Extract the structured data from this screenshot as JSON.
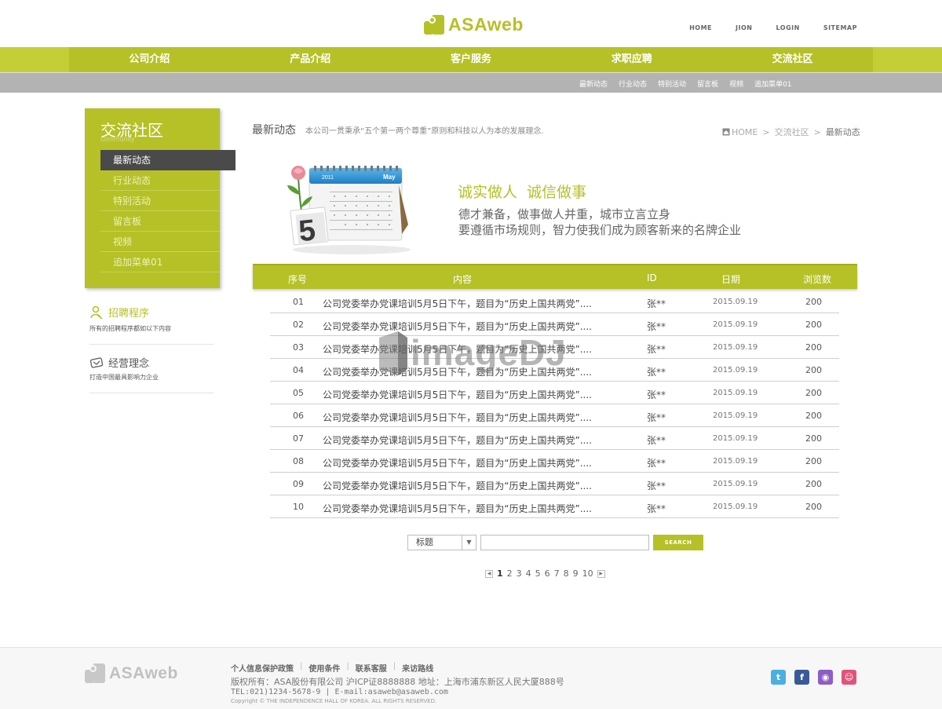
{
  "header": {
    "logo_text": "ASAweb",
    "top_links": [
      "HOME",
      "JION",
      "LOGIN",
      "SITEMAP"
    ]
  },
  "nav": {
    "items": [
      "公司介绍",
      "产品介绍",
      "客户服务",
      "求职应聘",
      "交流社区"
    ],
    "sub_items": [
      "最新动态",
      "行业动态",
      "特别活动",
      "留言板",
      "视频",
      "追加菜单01"
    ]
  },
  "sidebar": {
    "title": "交流社区",
    "subtitle": "community",
    "menu": [
      "最新动态",
      "行业动态",
      "特别活动",
      "留言板",
      "视频",
      "追加菜单01"
    ],
    "recruit_title": "招聘程序",
    "recruit_desc": "所有的招聘程序都如以下内容",
    "philosophy_title": "经营理念",
    "philosophy_desc": "打造中国最具影响力企业"
  },
  "main": {
    "title": "最新动态",
    "description": "本公司一贯秉承“五个第一两个尊重”原则和科技以人为本的发展理念.",
    "breadcrumb": [
      "HOME",
      "交流社区",
      "最新动态"
    ],
    "banner": {
      "cal_year": "2011",
      "cal_month": "May",
      "cal_day": "5",
      "slogan_title": "诚实做人  诚信做事",
      "slogan_line1": "德才兼备，做事做人并重，城市立言立身",
      "slogan_line2": "要遵循市场规则，智力使我们成为顾客新来的名牌企业"
    },
    "table": {
      "headers": {
        "no": "序号",
        "content": "内容",
        "id": "ID",
        "date": "日期",
        "views": "浏览数"
      },
      "rows": [
        {
          "no": "01",
          "content": "公司党委举办党课培训5月5日下午，题目为“历史上国共两党”....",
          "id": "张**",
          "date": "2015.09.19",
          "views": "200"
        },
        {
          "no": "02",
          "content": "公司党委举办党课培训5月5日下午，题目为“历史上国共两党”....",
          "id": "张**",
          "date": "2015.09.19",
          "views": "200"
        },
        {
          "no": "03",
          "content": "公司党委举办党课培训5月5日下午，题目为“历史上国共两党”....",
          "id": "张**",
          "date": "2015.09.19",
          "views": "200"
        },
        {
          "no": "04",
          "content": "公司党委举办党课培训5月5日下午，题目为“历史上国共两党”....",
          "id": "张**",
          "date": "2015.09.19",
          "views": "200"
        },
        {
          "no": "05",
          "content": "公司党委举办党课培训5月5日下午，题目为“历史上国共两党”....",
          "id": "张**",
          "date": "2015.09.19",
          "views": "200"
        },
        {
          "no": "06",
          "content": "公司党委举办党课培训5月5日下午，题目为“历史上国共两党”....",
          "id": "张**",
          "date": "2015.09.19",
          "views": "200"
        },
        {
          "no": "07",
          "content": "公司党委举办党课培训5月5日下午，题目为“历史上国共两党”....",
          "id": "张**",
          "date": "2015.09.19",
          "views": "200"
        },
        {
          "no": "08",
          "content": "公司党委举办党课培训5月5日下午，题目为“历史上国共两党”....",
          "id": "张**",
          "date": "2015.09.19",
          "views": "200"
        },
        {
          "no": "09",
          "content": "公司党委举办党课培训5月5日下午，题目为“历史上国共两党”....",
          "id": "张**",
          "date": "2015.09.19",
          "views": "200"
        },
        {
          "no": "10",
          "content": "公司党委举办党课培训5月5日下午，题目为“历史上国共两党”....",
          "id": "张**",
          "date": "2015.09.19",
          "views": "200"
        }
      ]
    },
    "search": {
      "select_value": "标题",
      "input_value": "",
      "button_label": "SEARCH"
    },
    "pagination": {
      "current": "1",
      "pages": [
        "1",
        "2",
        "3",
        "4",
        "5",
        "6",
        "7",
        "8",
        "9",
        "10"
      ]
    }
  },
  "watermark": {
    "text": "imageDJ"
  },
  "footer": {
    "logo_text": "ASAweb",
    "links": [
      "个人信息保护政策",
      "使用条件",
      "联系客服",
      "来访路线"
    ],
    "copyright": "版权所有：ASA股份有限公司 沪ICP证8888888 地址：上海市浦东新区人民大厦888号",
    "contact": "TEL:021)1234-5678-9 | E-mail:asaweb@asaweb.com",
    "rights": "Copyright © THE INDEPENDENCE HALL OF KOREA. ALL RIGHTS RESERVED."
  },
  "colors": {
    "brand": "#b5c127",
    "nav_outer": "#c4cf38",
    "sub_bar": "#b3b3b3",
    "active_menu": "#4a4a4a",
    "twitter": "#4bb0e0",
    "facebook": "#3b5998",
    "social3": "#8e5cc4",
    "social4": "#e0547a"
  }
}
